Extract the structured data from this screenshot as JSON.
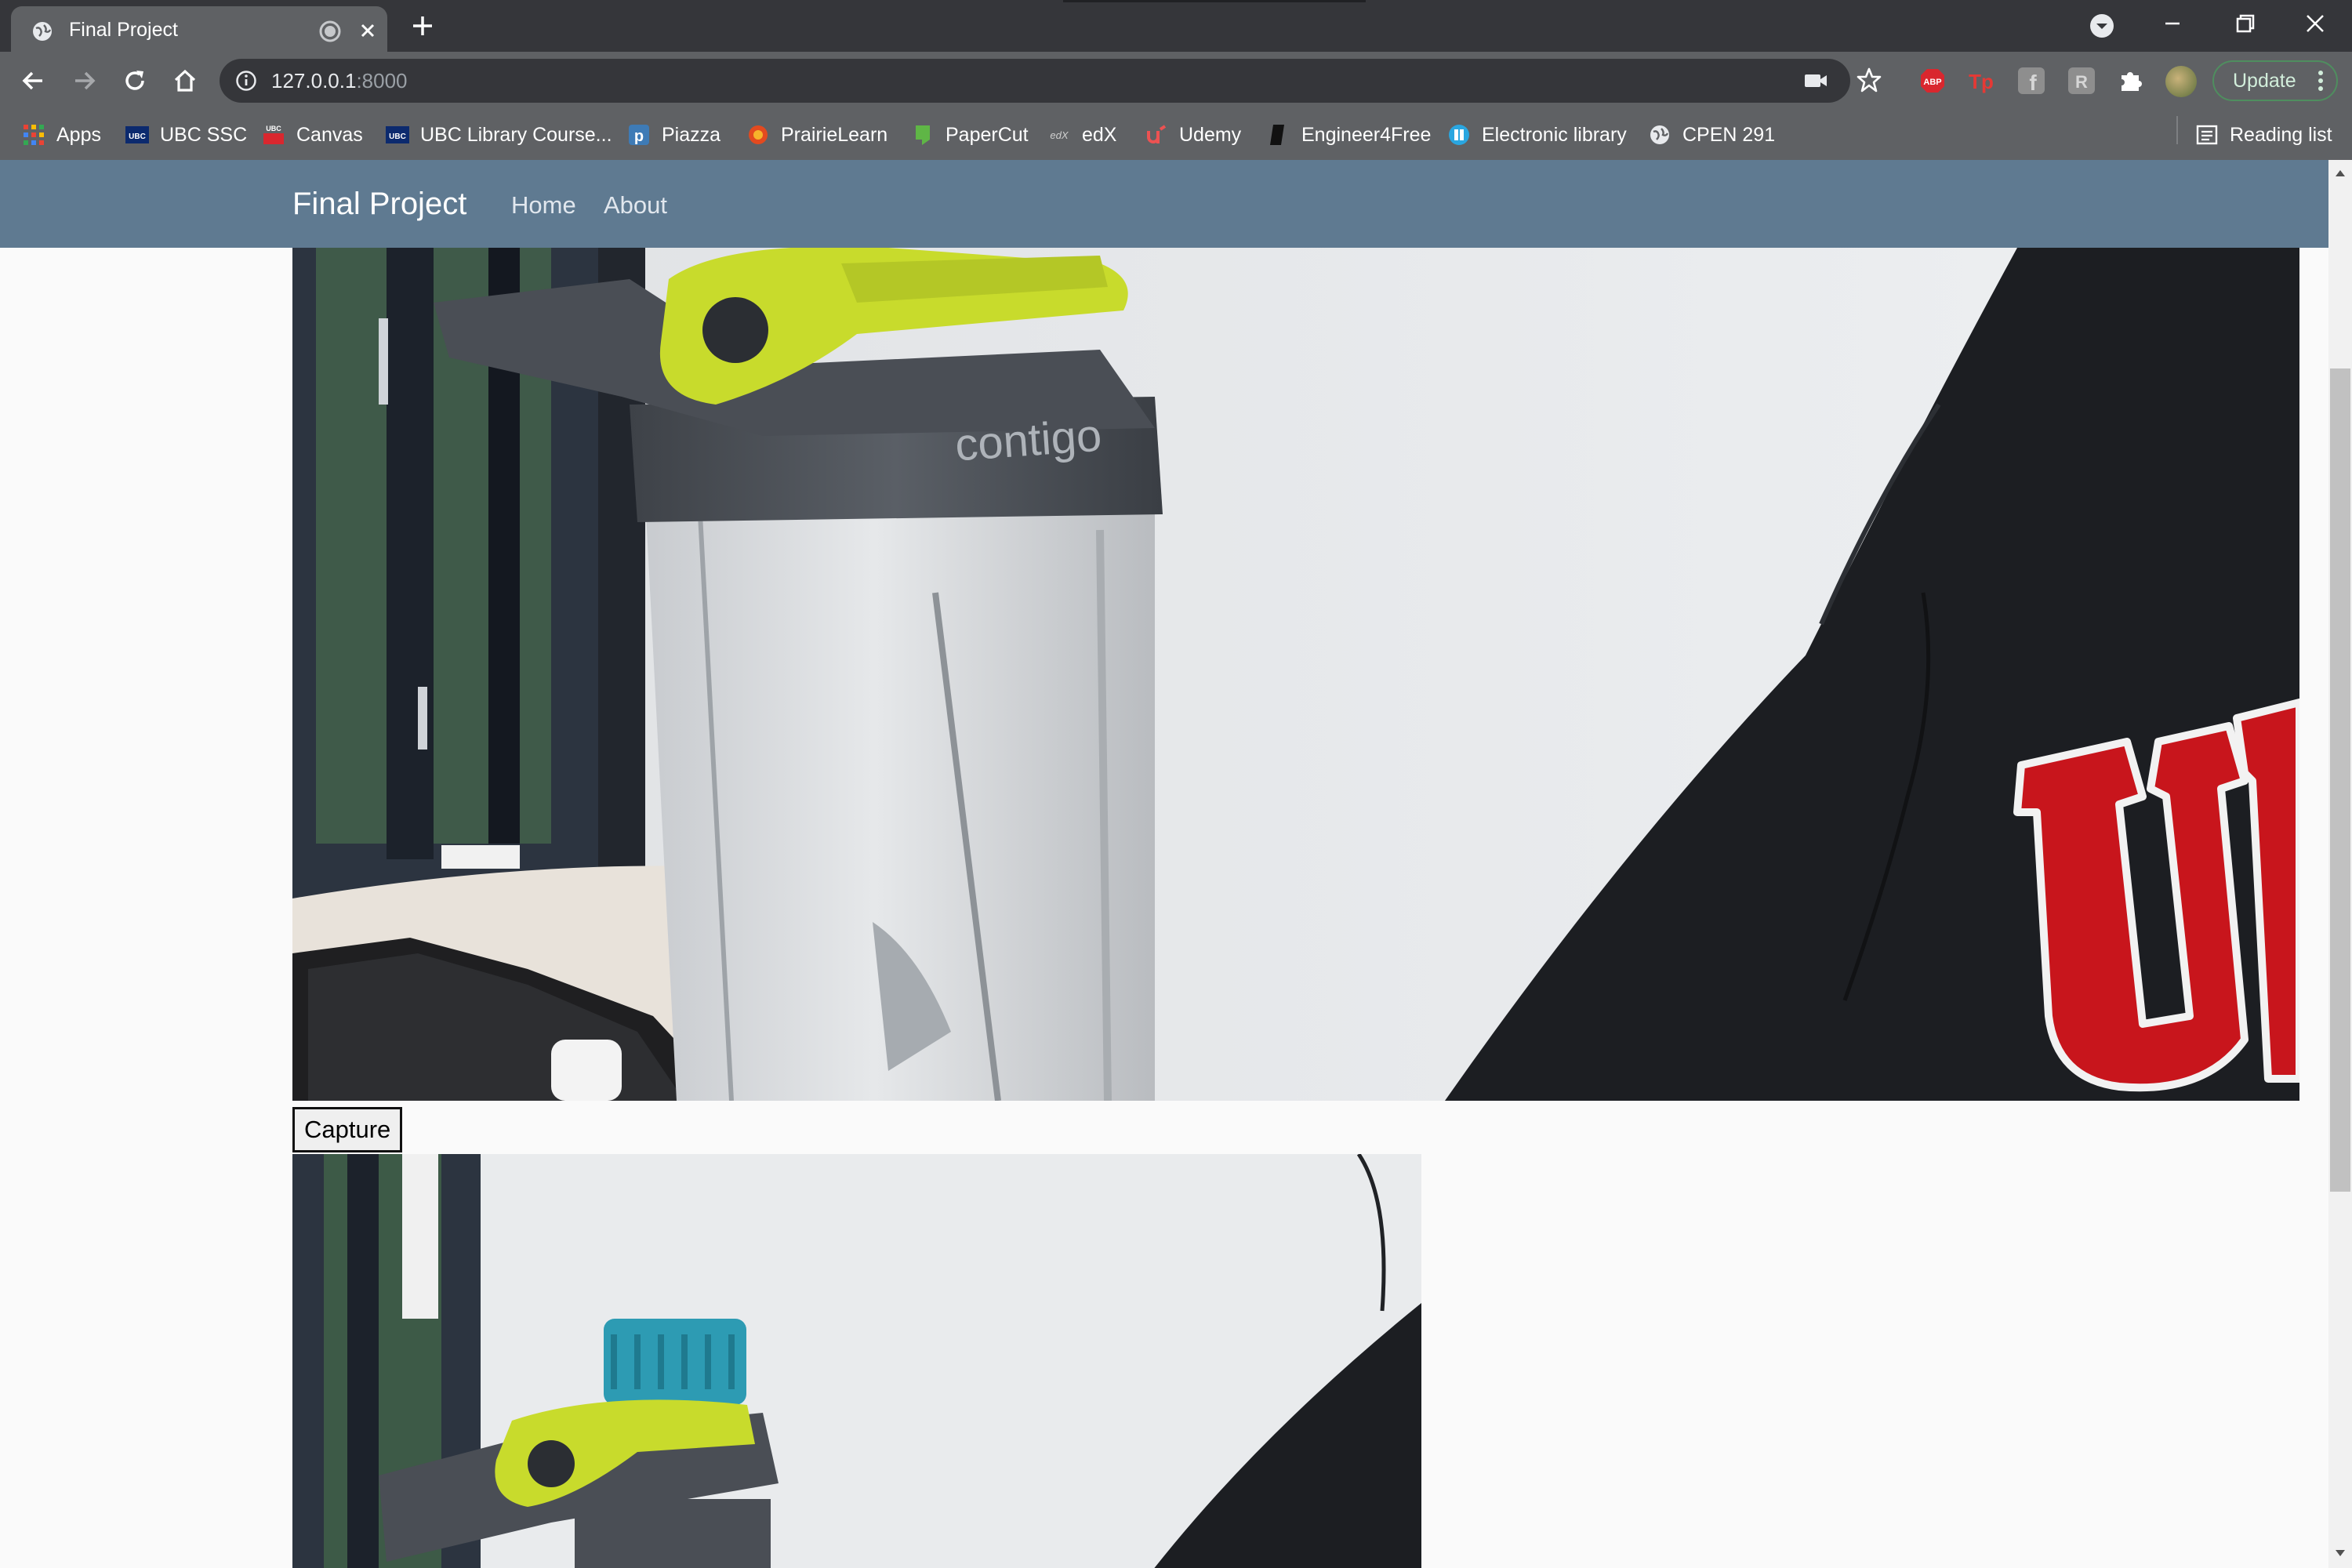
{
  "browser": {
    "tab": {
      "title": "Final Project",
      "favicon": "globe-icon"
    },
    "address_bar": {
      "host": "127.0.0.1",
      "port": ":8000",
      "info_icon": "info-icon"
    },
    "update_label": "Update",
    "reading_list_label": "Reading list",
    "bookmarks": [
      {
        "label": "Apps",
        "icon": "apps-grid-icon"
      },
      {
        "label": "UBC SSC",
        "icon": "ubc-icon"
      },
      {
        "label": "Canvas",
        "icon": "ubc-canvas-icon"
      },
      {
        "label": "UBC Library Course...",
        "icon": "ubc-icon"
      },
      {
        "label": "Piazza",
        "icon": "piazza-icon"
      },
      {
        "label": "PrairieLearn",
        "icon": "prairielearn-icon"
      },
      {
        "label": "PaperCut",
        "icon": "papercut-icon"
      },
      {
        "label": "edX",
        "icon": "edx-icon"
      },
      {
        "label": "Udemy",
        "icon": "udemy-icon"
      },
      {
        "label": "Engineer4Free",
        "icon": "engineer4free-icon"
      },
      {
        "label": "Electronic library",
        "icon": "electronic-library-icon"
      },
      {
        "label": "CPEN 291",
        "icon": "globe-icon"
      }
    ],
    "colors": {
      "tab_strip": "#35363a",
      "toolbar": "#5f6164",
      "update_border": "#4f8e5f"
    }
  },
  "page": {
    "brand": "Final Project",
    "nav": [
      {
        "label": "Home"
      },
      {
        "label": "About"
      }
    ],
    "capture_label": "Capture",
    "bottle_brand_text": "contigo",
    "colors": {
      "navbar": "#5f7a91",
      "background": "#fafafa"
    }
  }
}
